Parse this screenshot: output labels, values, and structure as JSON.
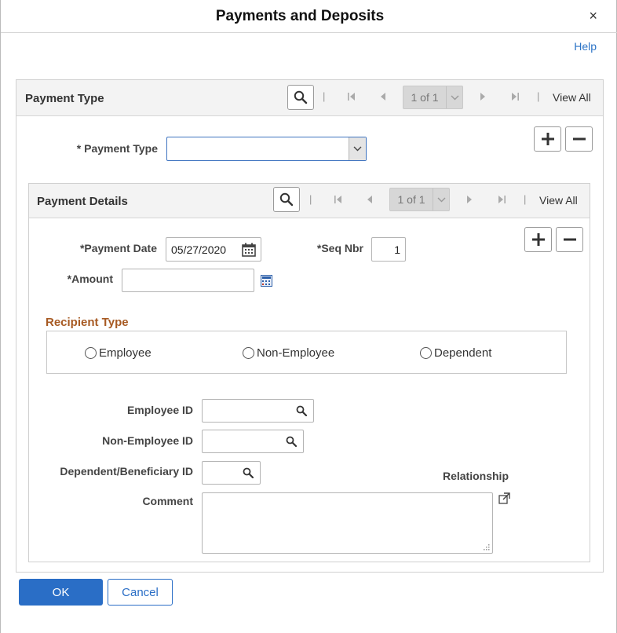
{
  "dialog": {
    "title": "Payments and Deposits",
    "close_glyph": "×",
    "help_label": "Help"
  },
  "payment_type_grid": {
    "title": "Payment Type",
    "pager_text": "1 of 1",
    "view_all": "View All",
    "field_label": "* Payment Type",
    "field_value": ""
  },
  "payment_details_grid": {
    "title": "Payment Details",
    "pager_text": "1 of 1",
    "view_all": "View All",
    "payment_date_label": "*Payment Date",
    "payment_date_value": "05/27/2020",
    "seq_nbr_label": "*Seq Nbr",
    "seq_nbr_value": "1",
    "amount_label": "*Amount",
    "amount_value": ""
  },
  "recipient": {
    "section_title": "Recipient Type",
    "options": [
      "Employee",
      "Non-Employee",
      "Dependent"
    ],
    "selected": ""
  },
  "ids": {
    "employee_id_label": "Employee ID",
    "non_employee_id_label": "Non-Employee ID",
    "dependent_id_label": "Dependent/Beneficiary ID",
    "relationship_label": "Relationship",
    "comment_label": "Comment"
  },
  "footer": {
    "ok_label": "OK",
    "cancel_label": "Cancel"
  },
  "colors": {
    "accent": "#2a6ec6",
    "section_title": "#a75a23",
    "grid_header": "#f3f3f3"
  },
  "icons": [
    "close-icon",
    "search-icon",
    "first-page-icon",
    "previous-page-icon",
    "next-page-icon",
    "last-page-icon",
    "chevron-down-icon",
    "add-row-icon",
    "delete-row-icon",
    "calendar-icon",
    "calculator-icon",
    "expand-icon",
    "resize-grip-icon"
  ]
}
